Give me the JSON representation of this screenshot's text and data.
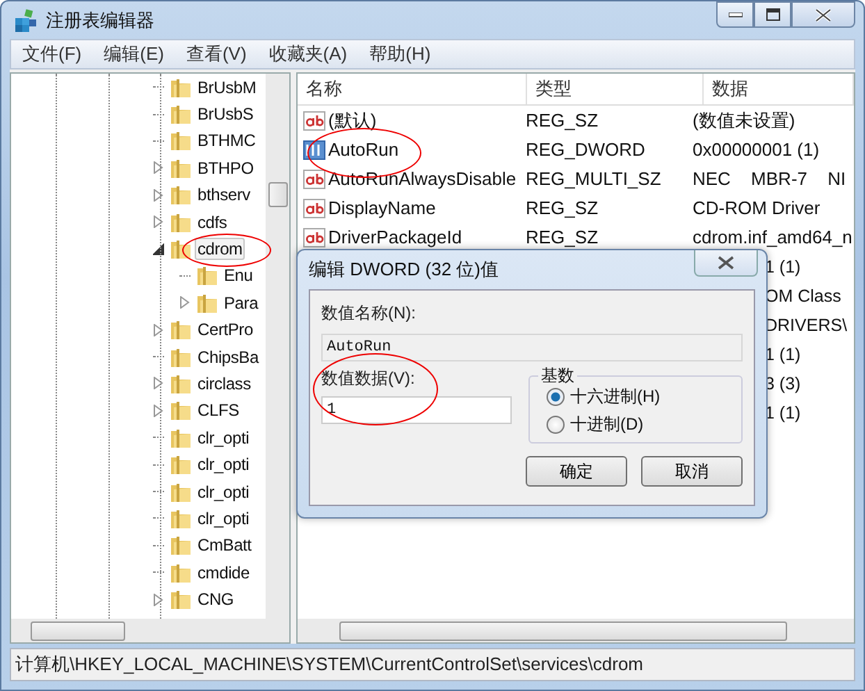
{
  "window": {
    "title": "注册表编辑器"
  },
  "menu": [
    "文件(F)",
    "编辑(E)",
    "查看(V)",
    "收藏夹(A)",
    "帮助(H)"
  ],
  "tree": {
    "items": [
      {
        "label": "BrUsbM",
        "selected": false
      },
      {
        "label": "BrUsbS",
        "selected": false
      },
      {
        "label": "BTHMC",
        "selected": false
      },
      {
        "label": "BTHPO",
        "expanded": false,
        "selected": false
      },
      {
        "label": "bthserv",
        "expanded": false,
        "selected": false
      },
      {
        "label": "cdfs",
        "expanded": false,
        "selected": false
      },
      {
        "label": "cdrom",
        "expanded": true,
        "selected": true,
        "children": [
          {
            "label": "Enu",
            "selected": false
          },
          {
            "label": "Para",
            "expanded": false,
            "selected": false
          }
        ]
      },
      {
        "label": "CertPro",
        "expanded": false,
        "selected": false
      },
      {
        "label": "ChipsBa",
        "selected": false
      },
      {
        "label": "circlass",
        "expanded": false,
        "selected": false
      },
      {
        "label": "CLFS",
        "expanded": false,
        "selected": false
      },
      {
        "label": "clr_opti",
        "selected": false
      },
      {
        "label": "clr_opti",
        "selected": false
      },
      {
        "label": "clr_opti",
        "selected": false
      },
      {
        "label": "clr_opti",
        "selected": false
      },
      {
        "label": "CmBatt",
        "selected": false
      },
      {
        "label": "cmdide",
        "selected": false
      },
      {
        "label": "CNG",
        "expanded": false,
        "selected": false
      }
    ]
  },
  "list": {
    "columns": [
      "名称",
      "类型",
      "数据"
    ],
    "rows": [
      {
        "kind": "string",
        "name": "(默认)",
        "type": "REG_SZ",
        "data": "(数值未设置)"
      },
      {
        "kind": "dword",
        "name": "AutoRun",
        "type": "REG_DWORD",
        "data": "0x00000001 (1)"
      },
      {
        "kind": "multi_string",
        "name": "AutoRunAlwaysDisable",
        "type": "REG_MULTI_SZ",
        "data": "NEC MBR-7 NI"
      },
      {
        "kind": "string",
        "name": "DisplayName",
        "type": "REG_SZ",
        "data": "CD-ROM Driver"
      },
      {
        "kind": "string",
        "name": "DriverPackageId",
        "type": "REG_SZ",
        "data": "cdrom.inf_amd64_n"
      },
      {
        "data": "1 (1)"
      },
      {
        "data": "OM Class"
      },
      {
        "data": "DRIVERS\\"
      },
      {
        "data": "1 (1)"
      },
      {
        "data": "3 (3)"
      },
      {
        "data": "1 (1)"
      }
    ]
  },
  "dialog": {
    "title": "编辑 DWORD (32 位)值",
    "name_label": "数值名称(N):",
    "name_value": "AutoRun",
    "data_label": "数值数据(V):",
    "data_value": "1",
    "base": {
      "label": "基数",
      "options": [
        {
          "label": "十六进制(H)",
          "selected": true
        },
        {
          "label": "十进制(D)",
          "selected": false
        }
      ]
    },
    "buttons": [
      "确定",
      "取消"
    ]
  },
  "status_bar": "计算机\\HKEY_LOCAL_MACHINE\\SYSTEM\\CurrentControlSet\\services\\cdrom"
}
